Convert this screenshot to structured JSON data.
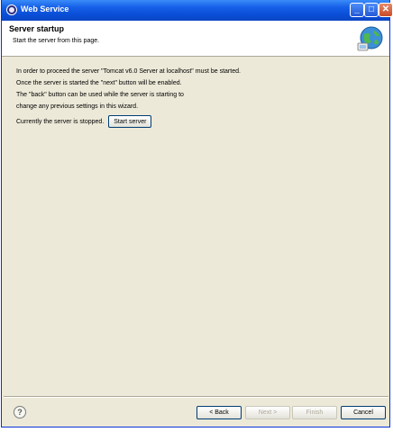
{
  "window": {
    "title": "Web Service",
    "controls": {
      "minimize": "_",
      "maximize": "□",
      "close": "✕"
    }
  },
  "banner": {
    "title": "Server startup",
    "subtitle": "Start the server from this page.",
    "icon": "globe-wizard-icon"
  },
  "body": {
    "lines": [
      "In order to proceed the server \"Tomcat v6.0 Server at localhost\" must be started.",
      "Once the server is started the \"next\" button will be enabled.",
      "The \"back\" button can be used while the server is starting to",
      "change any previous settings in this wizard."
    ],
    "status_text": "Currently the server is stopped.",
    "start_button": "Start server"
  },
  "footer": {
    "help": "?",
    "back": "< Back",
    "next": "Next >",
    "finish": "Finish",
    "cancel": "Cancel"
  },
  "colors": {
    "titlebar": "#0a4ed8",
    "dialog_bg": "#ece9d8",
    "disabled_text": "#aca899"
  }
}
